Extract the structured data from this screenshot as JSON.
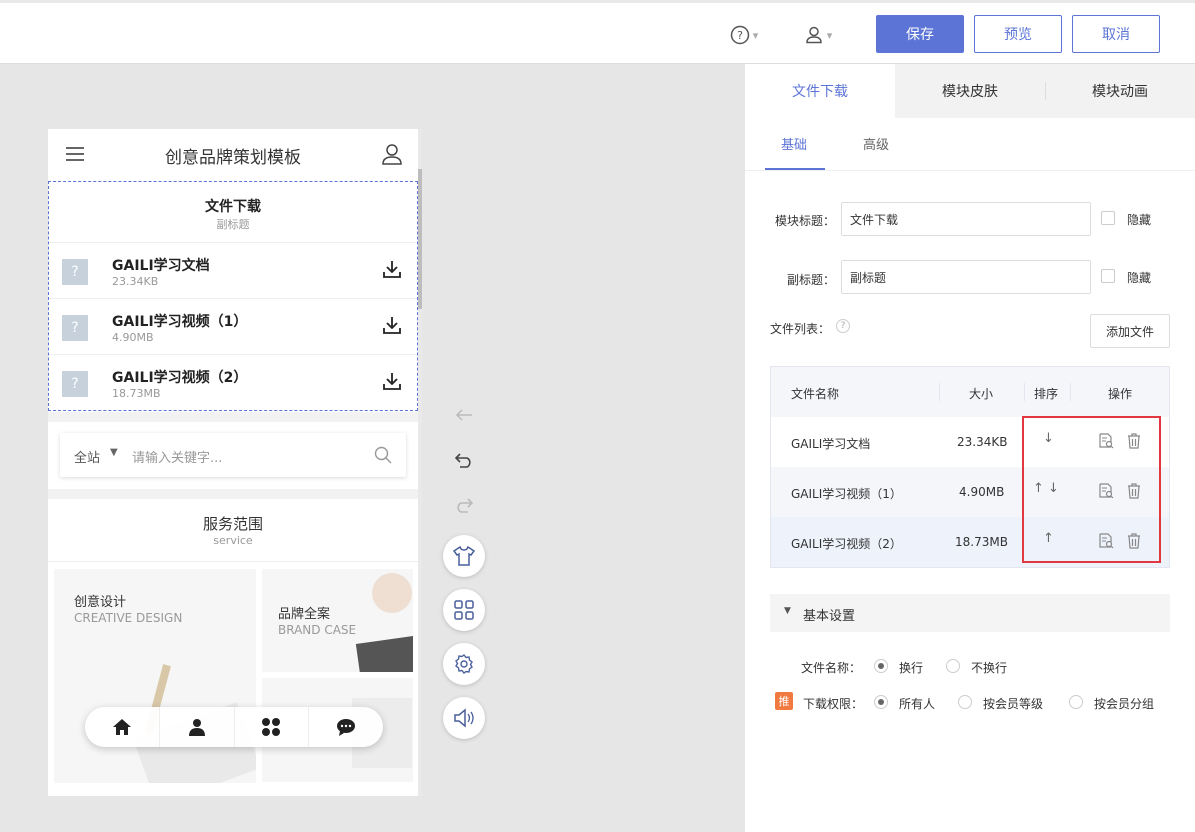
{
  "topbar": {
    "help_icon": "help-circle-icon",
    "user_icon": "user-icon",
    "save_label": "保存",
    "preview_label": "预览",
    "cancel_label": "取消"
  },
  "phone": {
    "title": "创意品牌策划模板",
    "download_module": {
      "title": "文件下载",
      "subtitle": "副标题",
      "files": [
        {
          "name": "GAILI学习文档",
          "size": "23.34KB"
        },
        {
          "name": "GAILI学习视频（1）",
          "size": "4.90MB"
        },
        {
          "name": "GAILI学习视频（2）",
          "size": "18.73MB"
        }
      ]
    },
    "search": {
      "scope": "全站",
      "placeholder": "请输入关键字..."
    },
    "services": {
      "title": "服务范围",
      "subtitle": "service",
      "cards": [
        {
          "title": "创意设计",
          "subtitle": "CREATIVE DESIGN"
        },
        {
          "title": "品牌全案",
          "subtitle": "BRAND CASE"
        }
      ]
    },
    "bottom_nav": [
      "home-icon",
      "person-icon",
      "apps-icon",
      "chat-icon"
    ]
  },
  "tools": [
    "arrow-left-icon",
    "undo-icon",
    "redo-icon",
    "skin-shirt-icon",
    "layout-grid-icon",
    "settings-gear-icon",
    "speaker-icon"
  ],
  "panel": {
    "tabs": [
      "文件下载",
      "模块皮肤",
      "模块动画"
    ],
    "subtabs": [
      "基础",
      "高级"
    ],
    "module_title_label": "模块标题：",
    "module_title_value": "文件下载",
    "subtitle_label": "副标题：",
    "subtitle_value": "副标题",
    "hide_label": "隐藏",
    "file_list_label": "文件列表：",
    "add_file_label": "添加文件",
    "table": {
      "headers": [
        "文件名称",
        "大小",
        "排序",
        "操作"
      ],
      "rows": [
        {
          "name": "GAILI学习文档",
          "size": "23.34KB",
          "sort": "↓"
        },
        {
          "name": "GAILI学习视频（1）",
          "size": "4.90MB",
          "sort": "↑ ↓"
        },
        {
          "name": "GAILI学习视频（2）",
          "size": "18.73MB",
          "sort": "↑"
        }
      ]
    },
    "basic_settings": "基本设置",
    "filename_label": "文件名称：",
    "filename_options": [
      "换行",
      "不换行"
    ],
    "filename_selected": "换行",
    "permission_badge": "推",
    "permission_label": "下载权限：",
    "permission_options": [
      "所有人",
      "按会员等级",
      "按会员分组"
    ],
    "permission_selected": "所有人",
    "accent_color": "#5b74d6",
    "highlight_color": "#e0383e"
  }
}
